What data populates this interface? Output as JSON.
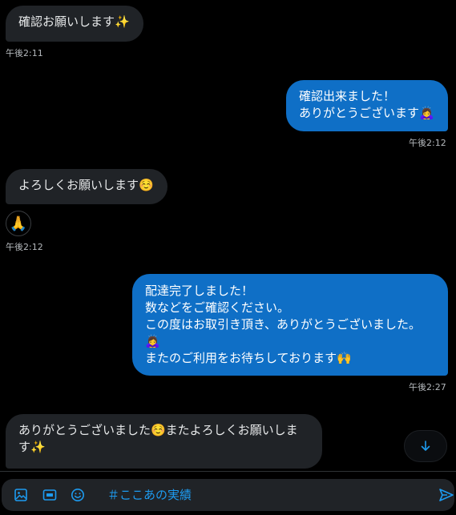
{
  "messages": [
    {
      "text": "確認お願いします✨",
      "time": "午後2:11"
    },
    {
      "text": "確認出来ました！\nありがとうございます🙇‍♀️",
      "time": "午後2:12"
    },
    {
      "text": "よろしくお願いします☺️",
      "reaction": "🙏",
      "time": "午後2:12"
    },
    {
      "text": "配達完了しました！\n数などをご確認ください。\nこの度はお取引き頂き、ありがとうございました。\n🙇‍♀️\nまたのご利用をお待ちしております🙌",
      "time": "午後2:27"
    },
    {
      "text": "ありがとうございました☺️またよろしくお願いしま\nす✨"
    }
  ],
  "composer": {
    "placeholder": "＃ここあの実績",
    "icons": [
      "image-icon",
      "gif-icon",
      "emoji-icon",
      "send-icon"
    ]
  },
  "scroll_button": {
    "icon": "arrow-down-icon"
  },
  "colors": {
    "background": "#000000",
    "incoming_bubble": "#202327",
    "outgoing_bubble": "#0f6fc6",
    "accent": "#1d9bf0",
    "timestamp": "#b4b8bc"
  }
}
